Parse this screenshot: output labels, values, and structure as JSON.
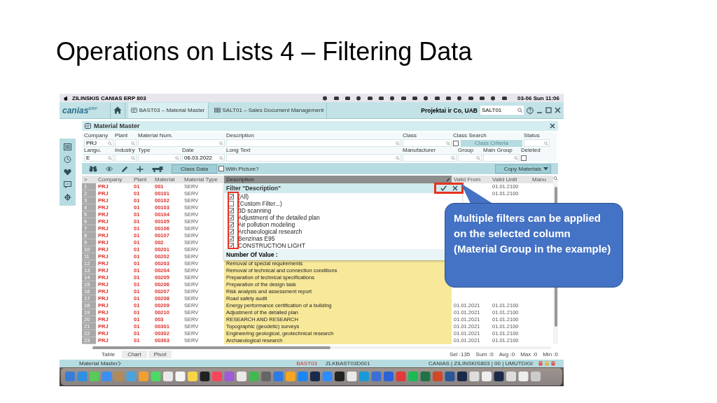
{
  "title": "Operations on Lists 4 – Filtering Data",
  "menu_bar": {
    "app_name": "ZILINSKIS CANIAS ERP 803",
    "clock": "03-06 Sun 11:06"
  },
  "app_header": {
    "logo": "canias$^{ERP}$",
    "tabs": [
      {
        "label": "BAST03 – Material Master",
        "selected": true
      },
      {
        "label": "SALT01 – Sales Document Management",
        "selected": false
      }
    ],
    "company": "Projektai ir Co, UAB",
    "search": {
      "value": "SALT01"
    }
  },
  "panel": {
    "title": "Material Master"
  },
  "form": {
    "fields": [
      {
        "kind": "text",
        "label": "Company",
        "value": "PRJ"
      },
      {
        "kind": "text",
        "label": "Plant"
      },
      {
        "kind": "text",
        "label": "Material Num."
      },
      {
        "kind": "text",
        "label": "Description"
      },
      {
        "kind": "text",
        "label": "Class"
      },
      {
        "kind": "checkbox-button",
        "label": "Class Search",
        "checked": false,
        "button": "Class Criteria",
        "disabled": true
      },
      {
        "kind": "text",
        "label": "Status"
      },
      {
        "kind": "text",
        "label": "Langu.",
        "value": "E"
      },
      {
        "kind": "text",
        "label": "Industry"
      },
      {
        "kind": "text",
        "label": "Type"
      },
      {
        "kind": "text",
        "label": "Date",
        "value": "06.03.2022"
      },
      {
        "kind": "text",
        "label": "Long Text"
      },
      {
        "kind": "text",
        "label": "Manufacturer"
      },
      {
        "kind": "text",
        "label": "Group"
      },
      {
        "kind": "text",
        "label": "Main Group"
      },
      {
        "kind": "checkbox",
        "label": "Deleted",
        "checked": false
      }
    ]
  },
  "toolbar": {
    "class_data": "Class Data",
    "with_picture": {
      "label": "With Picture?",
      "checked": false
    },
    "copy_menu": "Copy Materials"
  },
  "table": {
    "columns": [
      {
        "label": ">",
        "selected": false
      },
      {
        "label": "Company",
        "selected": false
      },
      {
        "label": "Plant",
        "selected": false
      },
      {
        "label": "Material",
        "selected": false
      },
      {
        "label": "Material Type",
        "selected": false
      },
      {
        "label": "Description",
        "selected": true
      },
      {
        "label": "Valid From",
        "selected": false
      },
      {
        "label": "Valid Until",
        "selected": false
      },
      {
        "label": "Manu",
        "selected": false
      }
    ],
    "rows": [
      {
        "n": "1",
        "company": "PRJ",
        "plant": "01",
        "material": "001",
        "type": "SERV",
        "valid_until": "01.01.2100"
      },
      {
        "n": "2",
        "company": "PRJ",
        "plant": "01",
        "material": "00101",
        "type": "SERV",
        "valid_until": "01.01.2100"
      },
      {
        "n": "3",
        "company": "PRJ",
        "plant": "01",
        "material": "00102",
        "type": "SERV"
      },
      {
        "n": "4",
        "company": "PRJ",
        "plant": "01",
        "material": "00103",
        "type": "SERV"
      },
      {
        "n": "5",
        "company": "PRJ",
        "plant": "01",
        "material": "00104",
        "type": "SERV"
      },
      {
        "n": "6",
        "company": "PRJ",
        "plant": "01",
        "material": "00105",
        "type": "SERV"
      },
      {
        "n": "7",
        "company": "PRJ",
        "plant": "01",
        "material": "00106",
        "type": "SERV"
      },
      {
        "n": "8",
        "company": "PRJ",
        "plant": "01",
        "material": "00107",
        "type": "SERV"
      },
      {
        "n": "9",
        "company": "PRJ",
        "plant": "01",
        "material": "002",
        "type": "SERV"
      },
      {
        "n": "10",
        "company": "PRJ",
        "plant": "01",
        "material": "00201",
        "type": "SERV"
      },
      {
        "n": "11",
        "company": "PRJ",
        "plant": "01",
        "material": "00202",
        "type": "SERV"
      },
      {
        "n": "12",
        "company": "PRJ",
        "plant": "01",
        "material": "00203",
        "type": "SERV",
        "description": "Removal of special requirements"
      },
      {
        "n": "13",
        "company": "PRJ",
        "plant": "01",
        "material": "00204",
        "type": "SERV",
        "description": "Removal of technical and connection conditions"
      },
      {
        "n": "14",
        "company": "PRJ",
        "plant": "01",
        "material": "00205",
        "type": "SERV",
        "description": "Preparation of technical specifications"
      },
      {
        "n": "15",
        "company": "PRJ",
        "plant": "01",
        "material": "00206",
        "type": "SERV",
        "description": "Preparation of the design task"
      },
      {
        "n": "16",
        "company": "PRJ",
        "plant": "01",
        "material": "00207",
        "type": "SERV",
        "description": "Risk analysis and assessment report"
      },
      {
        "n": "17",
        "company": "PRJ",
        "plant": "01",
        "material": "00208",
        "type": "SERV",
        "description": "Road safety audit"
      },
      {
        "n": "18",
        "company": "PRJ",
        "plant": "01",
        "material": "00209",
        "type": "SERV",
        "description": "Energy performance certification of a building",
        "valid_from": "01.01.2021",
        "valid_until": "01.01.2100"
      },
      {
        "n": "19",
        "company": "PRJ",
        "plant": "01",
        "material": "00210",
        "type": "SERV",
        "description": "Adjustment of the detailed plan",
        "valid_from": "01.01.2021",
        "valid_until": "01.01.2100"
      },
      {
        "n": "20",
        "company": "PRJ",
        "plant": "01",
        "material": "003",
        "type": "SERV",
        "description": "RESEARCH AND RESEARCH",
        "valid_from": "01.01.2021",
        "valid_until": "01.01.2100"
      },
      {
        "n": "21",
        "company": "PRJ",
        "plant": "01",
        "material": "00301",
        "type": "SERV",
        "description": "Topographic (geodetic) surveys",
        "valid_from": "01.01.2021",
        "valid_until": "01.01.2100"
      },
      {
        "n": "22",
        "company": "PRJ",
        "plant": "01",
        "material": "00302",
        "type": "SERV",
        "description": "Engineering geological, geotechnical research",
        "valid_from": "01.01.2021",
        "valid_until": "01.01.2100"
      },
      {
        "n": "23",
        "company": "PRJ",
        "plant": "01",
        "material": "00303",
        "type": "SERV",
        "description": "Archaeological research",
        "valid_from": "01.01.2021",
        "valid_until": "01.01.2100"
      }
    ]
  },
  "filter": {
    "title": "Filter \"Description\"",
    "items": [
      {
        "label": "(All)",
        "checked": true
      },
      {
        "label": "(Custom Filter...)",
        "checked": false
      },
      {
        "label": "3D scanning",
        "checked": true
      },
      {
        "label": "Adjustment of the detailed plan",
        "checked": true
      },
      {
        "label": "Air pollution modeling",
        "checked": true
      },
      {
        "label": "Archaeological research",
        "checked": true
      },
      {
        "label": "Benzinas E95",
        "checked": true
      },
      {
        "label": "CONSTRUCTION LIGHT",
        "checked": true
      }
    ],
    "footer": "Number Of Value :"
  },
  "view_tabs": [
    {
      "label": "Table",
      "selected": true
    },
    {
      "label": "Chart",
      "selected": false
    },
    {
      "label": "Pivot",
      "selected": false
    }
  ],
  "stats": [
    "Sel :135",
    "Sum :0",
    "Avg :0",
    "Max :0",
    "Min :0"
  ],
  "status_bar": {
    "screen": "Material Master",
    "program": "BAST03",
    "code": "ZLKBAST03D001",
    "session": "CANIAS | ZILINSKIS803 | 00 | UMUTDIGI"
  },
  "callout": {
    "text": "Multiple filters can be applied on the selected column (Material Group in the example)"
  }
}
